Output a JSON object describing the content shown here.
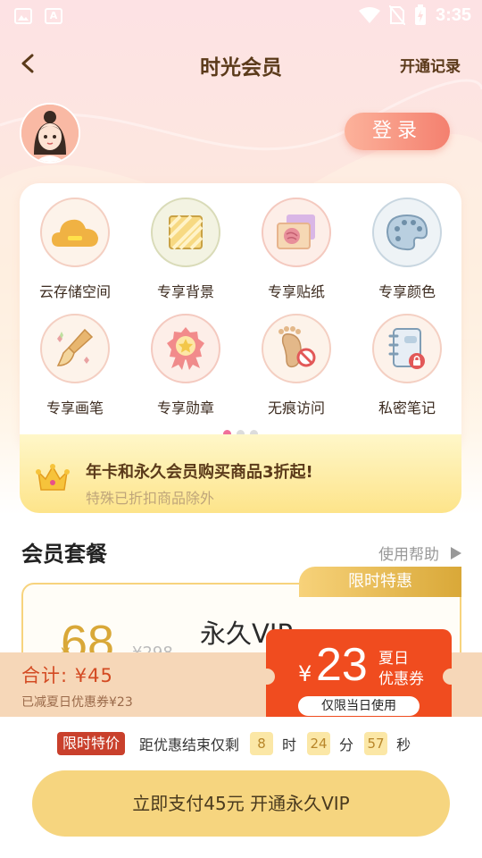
{
  "status_bar": {
    "time": "3:35"
  },
  "header": {
    "title": "时光会员",
    "record": "开通记录"
  },
  "login": {
    "label": "登录"
  },
  "privileges": [
    {
      "label": "云存储空间",
      "icon": "cloud-icon"
    },
    {
      "label": "专享背景",
      "icon": "background-icon"
    },
    {
      "label": "专享贴纸",
      "icon": "sticker-icon"
    },
    {
      "label": "专享颜色",
      "icon": "palette-icon"
    },
    {
      "label": "专享画笔",
      "icon": "brush-icon"
    },
    {
      "label": "专享勋章",
      "icon": "medal-icon"
    },
    {
      "label": "无痕访问",
      "icon": "footprint-icon"
    },
    {
      "label": "私密笔记",
      "icon": "private-notebook-icon"
    }
  ],
  "promo": {
    "title": "年卡和永久会员购买商品3折起!",
    "subtitle": "特殊已折扣商品除外"
  },
  "plans": {
    "section_title": "会员套餐",
    "help": "使用帮助",
    "limited_tag": "限时特惠",
    "plan_name": "永久VIP",
    "currency": "¥",
    "price": "68",
    "original_price": "¥298"
  },
  "total": {
    "label": "合计: ¥45",
    "saved": "已减夏日优惠券¥23"
  },
  "coupon": {
    "currency": "¥",
    "amount": "23",
    "title_line1": "夏日",
    "title_line2": "优惠券",
    "note": "仅限当日使用"
  },
  "countdown": {
    "tag": "限时特价",
    "text": "距优惠结束仅剩",
    "hours": "8",
    "hours_unit": "时",
    "minutes": "24",
    "minutes_unit": "分",
    "seconds": "57",
    "seconds_unit": "秒"
  },
  "pay_button": {
    "label": "立即支付45元 开通永久VIP"
  },
  "colors": {
    "accent_gold": "#d9a838",
    "coupon_red": "#f04c1f",
    "login_coral": "#f4806f",
    "title_brown": "#5b3a1a"
  }
}
